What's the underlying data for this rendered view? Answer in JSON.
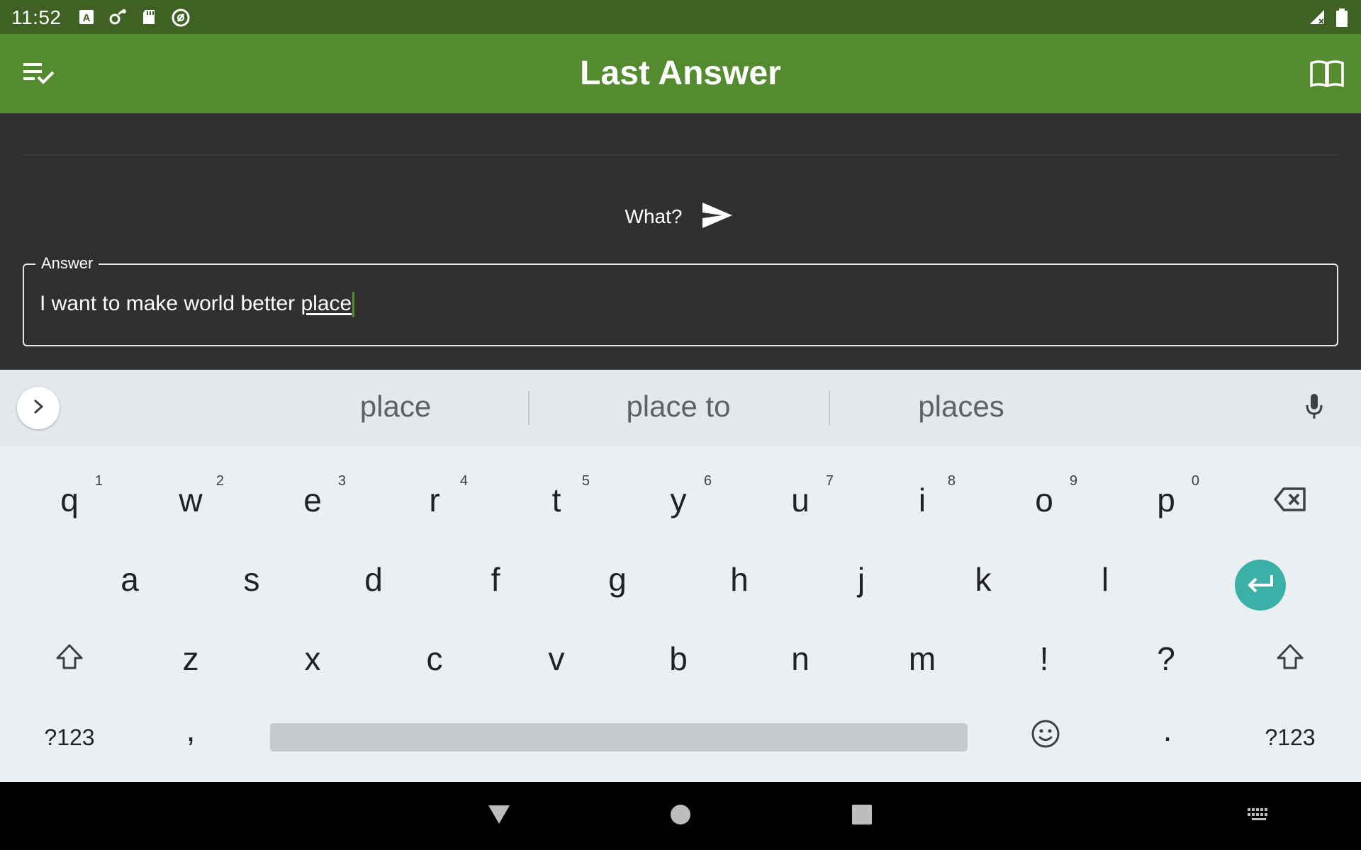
{
  "status_bar": {
    "time": "11:52",
    "icons": [
      "autofill-icon",
      "settings-sync-icon",
      "sd-card-icon",
      "do-not-disturb-icon",
      "signal-icon",
      "battery-icon"
    ]
  },
  "app_bar": {
    "title": "Last Answer",
    "left_icon": "playlist-check-icon",
    "right_icon": "book-open-icon"
  },
  "question": {
    "text": "What?",
    "send_icon": "send-icon"
  },
  "answer_field": {
    "label": "Answer",
    "value_prefix": "I want to make world better ",
    "value_composing": "place"
  },
  "suggestions": [
    "place",
    "place to",
    "places"
  ],
  "keyboard": {
    "row1": [
      {
        "key": "q",
        "hint": "1"
      },
      {
        "key": "w",
        "hint": "2"
      },
      {
        "key": "e",
        "hint": "3"
      },
      {
        "key": "r",
        "hint": "4"
      },
      {
        "key": "t",
        "hint": "5"
      },
      {
        "key": "y",
        "hint": "6"
      },
      {
        "key": "u",
        "hint": "7"
      },
      {
        "key": "i",
        "hint": "8"
      },
      {
        "key": "o",
        "hint": "9"
      },
      {
        "key": "p",
        "hint": "0"
      }
    ],
    "row2": [
      "a",
      "s",
      "d",
      "f",
      "g",
      "h",
      "j",
      "k",
      "l"
    ],
    "row3": [
      "z",
      "x",
      "c",
      "v",
      "b",
      "n",
      "m",
      "!",
      "?"
    ],
    "symbols_label": "?123",
    "comma": ",",
    "period": "."
  },
  "colors": {
    "status_bar": "#3f6224",
    "app_bar": "#558b2f",
    "background": "#303030",
    "enter_key": "#3ab0a6"
  }
}
